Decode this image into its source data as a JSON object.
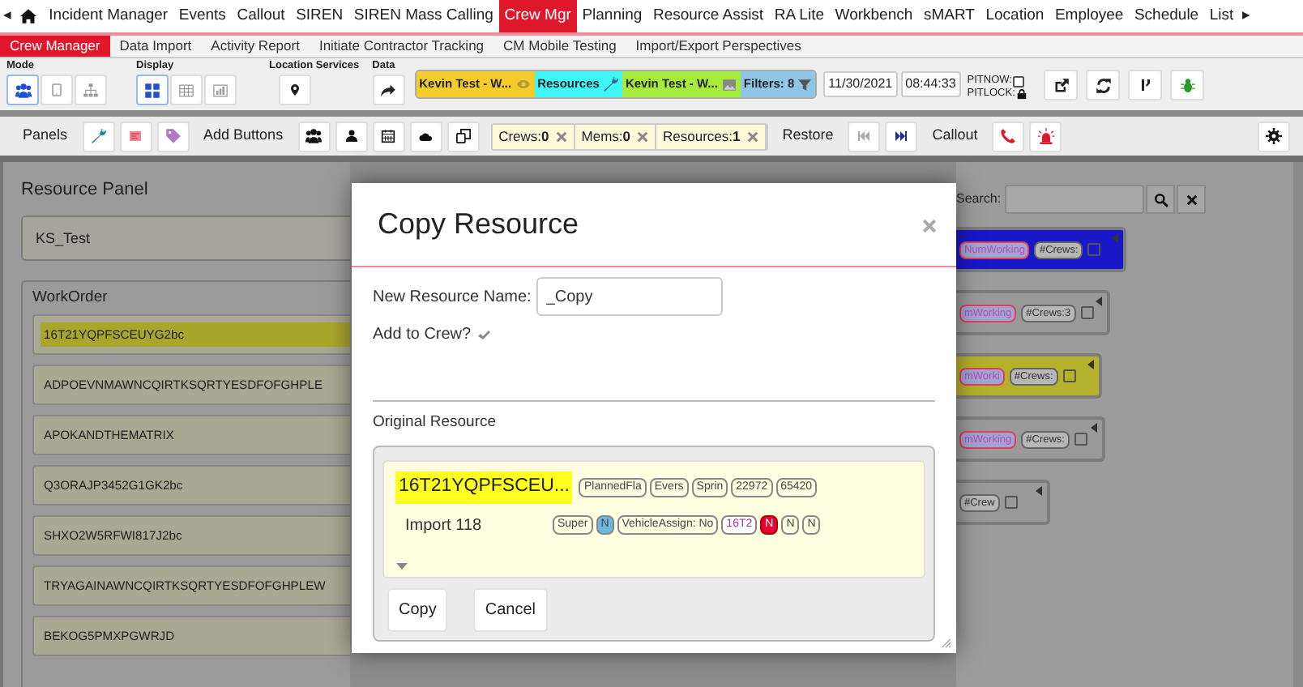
{
  "top_nav": {
    "scroll_left": "◂",
    "scroll_right": "▸",
    "items": [
      {
        "label": "Incident Manager",
        "selected": false
      },
      {
        "label": "Events",
        "selected": false
      },
      {
        "label": "Callout",
        "selected": false
      },
      {
        "label": "SIREN",
        "selected": false
      },
      {
        "label": "SIREN Mass Calling",
        "selected": false
      },
      {
        "label": "Crew Mgr",
        "selected": true
      },
      {
        "label": "Planning",
        "selected": false
      },
      {
        "label": "Resource Assist",
        "selected": false
      },
      {
        "label": "RA Lite",
        "selected": false
      },
      {
        "label": "Workbench",
        "selected": false
      },
      {
        "label": "sMART",
        "selected": false
      },
      {
        "label": "Location",
        "selected": false
      },
      {
        "label": "Employee",
        "selected": false
      },
      {
        "label": "Schedule",
        "selected": false
      },
      {
        "label": "List",
        "selected": false
      }
    ]
  },
  "sub_nav": {
    "items": [
      {
        "label": "Crew Manager",
        "selected": true
      },
      {
        "label": "Data Import",
        "selected": false
      },
      {
        "label": "Activity Report",
        "selected": false
      },
      {
        "label": "Initiate Contractor Tracking",
        "selected": false
      },
      {
        "label": "CM Mobile Testing",
        "selected": false
      },
      {
        "label": "Import/Export Perspectives",
        "selected": false
      }
    ]
  },
  "toolbar": {
    "mode_label": "Mode",
    "mode_buttons": [
      {
        "selected": true
      },
      {
        "selected": false
      },
      {
        "selected": false
      }
    ],
    "display_label": "Display",
    "display_buttons": [
      {
        "selected": true
      },
      {
        "selected": false
      },
      {
        "selected": false
      }
    ],
    "location_label": "Location Services",
    "data_label": "Data",
    "perspectives": [
      {
        "label": "Kevin Test - W...",
        "color": "#f5cc2a"
      },
      {
        "label": "Resources",
        "color": "#3ff5f5"
      },
      {
        "label": "Kevin Test - W...",
        "color": "#a6ea3c"
      },
      {
        "label": "Filters: 8",
        "color": "#8fc6e6"
      }
    ],
    "date": "11/30/2021",
    "time": "08:44:33",
    "pitnow_label": "PITNOW:",
    "pitnow_checked": false,
    "pitlock_label": "PITLOCK:"
  },
  "toolbar2": {
    "panels_label": "Panels",
    "add_buttons_label": "Add Buttons",
    "counters": [
      {
        "label": "Crews:",
        "count": "0"
      },
      {
        "label": "Mems:",
        "count": "0"
      },
      {
        "label": "Resources:",
        "count": "1"
      }
    ],
    "restore_label": "Restore",
    "callout_label": "Callout"
  },
  "resource_panel": {
    "title": "Resource Panel",
    "group": "KS_Test",
    "section": "WorkOrder",
    "items": [
      {
        "label": "16T21YQPFSCEUYG2bc",
        "selected": true
      },
      {
        "label": "ADPOEVNMAWNCQIRTKSQRTYESDFOFGHPLE",
        "selected": false
      },
      {
        "label": "APOKANDTHEMATRIX",
        "selected": false
      },
      {
        "label": "Q3ORAJP3452G1GK2bc",
        "selected": false
      },
      {
        "label": "SHXO2W5RFWI817J2bc",
        "selected": false
      },
      {
        "label": "TRYAGAINAWNCQIRTKSQRTYESDFOFGHPLEW",
        "selected": false
      },
      {
        "label": "BEKOG5PMXPGWRJD",
        "selected": false
      }
    ]
  },
  "crew_panel": {
    "search_label": "Search:",
    "cards": [
      {
        "tags": [
          "NumWorking",
          "#Crews:"
        ],
        "color": "#1818c8",
        "checked": false
      },
      {
        "tags": [
          "mWorking",
          "#Crews:3"
        ],
        "color": "#9a9a9a",
        "checked": false
      },
      {
        "tags": [
          "mWorki",
          "#Crews:"
        ],
        "color": "#b5b12c",
        "checked": false
      },
      {
        "tags": [
          "mWorking",
          "#Crews:"
        ],
        "color": "#9a9a9a",
        "checked": false
      },
      {
        "tags": [
          "#Crew"
        ],
        "color": "#9a9a9a",
        "checked": false
      }
    ]
  },
  "modal": {
    "title": "Copy Resource",
    "name_label": "New Resource Name:",
    "name_value": "_Copy",
    "add_to_crew_label": "Add to Crew?",
    "add_to_crew": true,
    "original_label": "Original Resource",
    "resource": {
      "title": "16T21YQPFSCEU...",
      "subtitle": "Import 118",
      "tags_row_1": [
        {
          "text": "PlannedFla",
          "kind": "plain"
        },
        {
          "text": "Evers",
          "kind": "plain"
        },
        {
          "text": "Sprin",
          "kind": "plain"
        },
        {
          "text": "22972",
          "kind": "plain"
        },
        {
          "text": "65420",
          "kind": "plain"
        }
      ],
      "tags_row_2": [
        {
          "text": "Super",
          "kind": "plain"
        },
        {
          "text": "N",
          "kind": "info"
        },
        {
          "text": "VehicleAssign: No",
          "kind": "plain"
        },
        {
          "text": "16T2",
          "kind": "purple"
        },
        {
          "text": "N",
          "kind": "danger"
        },
        {
          "text": "N",
          "kind": "plain"
        },
        {
          "text": "N",
          "kind": "plain"
        }
      ]
    },
    "buttons": [
      "Copy",
      "Cancel"
    ]
  }
}
